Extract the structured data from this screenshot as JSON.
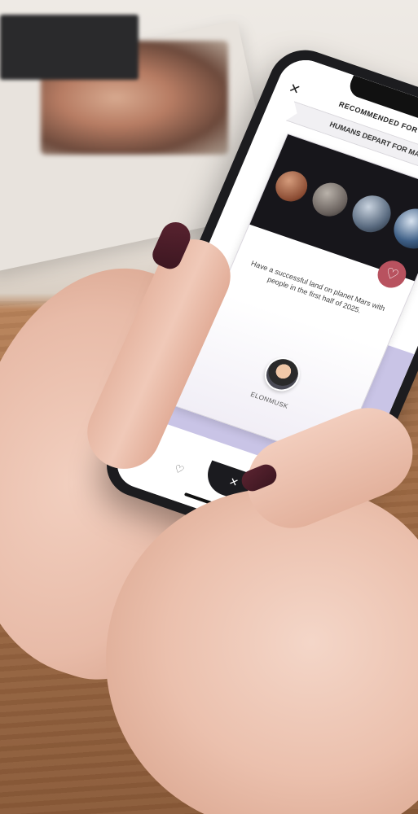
{
  "app": {
    "header_title": "RECOMMENDED FOR YOU",
    "close_icon": "close-icon",
    "search_icon": "search-icon"
  },
  "card": {
    "headline": "HUMANS DEPART FOR MARS",
    "description": "Have a successful land on planet Mars with people in the first half of 2025.",
    "author": "ELONMUSK",
    "image": "planets-image",
    "like_icon": "heart-icon"
  },
  "tabbar": {
    "items": [
      {
        "icon": "star-icon",
        "glyph": "★"
      },
      {
        "icon": "heart-icon",
        "glyph": "♡"
      },
      {
        "icon": "close-icon",
        "glyph": "✕"
      },
      {
        "icon": "user-icon",
        "glyph": "⚇"
      },
      {
        "icon": "bell-icon",
        "glyph": "🔔"
      }
    ]
  },
  "colors": {
    "accent": "#b8525f",
    "lavender": "#c9c4e6",
    "phone_frame": "#1c1c1f",
    "nail_polish": "#4a1c27"
  }
}
